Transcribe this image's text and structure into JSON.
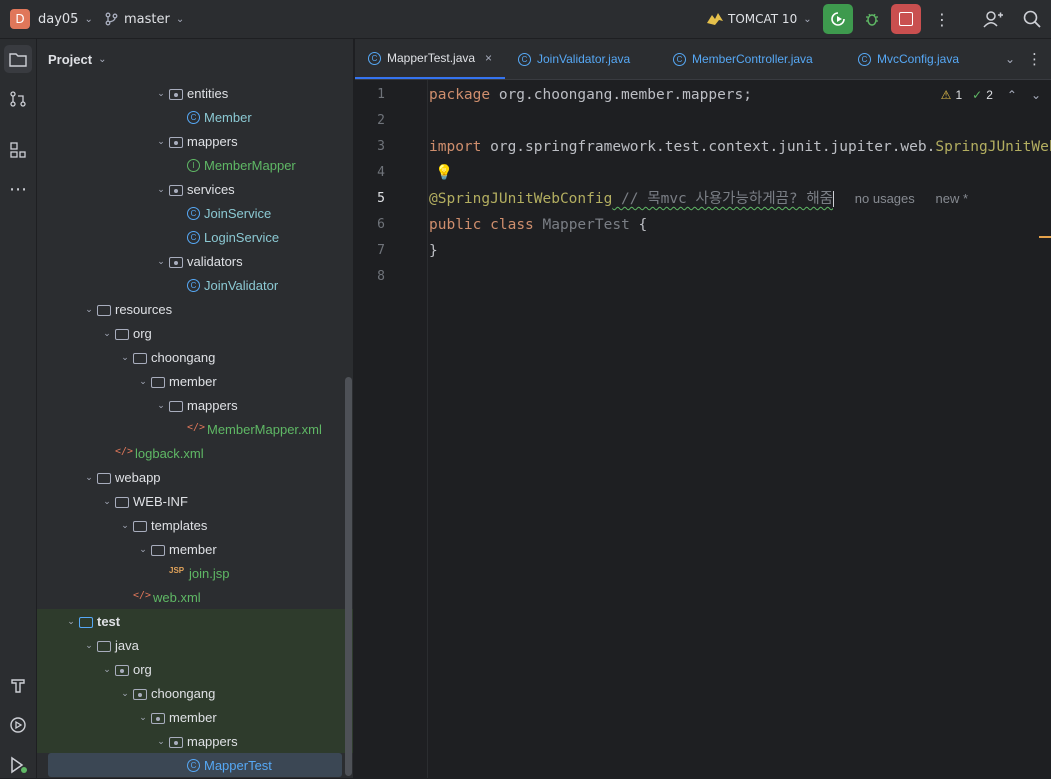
{
  "topbar": {
    "project_badge": "D",
    "project_name": "day05",
    "branch_name": "master",
    "run_config": "TOMCAT 10"
  },
  "panel": {
    "title": "Project"
  },
  "tree": [
    {
      "label": "entities",
      "type": "package",
      "indent": 6,
      "expanded": true
    },
    {
      "label": "Member",
      "type": "class",
      "indent": 7
    },
    {
      "label": "mappers",
      "type": "package",
      "indent": 6,
      "expanded": true
    },
    {
      "label": "MemberMapper",
      "type": "interface",
      "indent": 7
    },
    {
      "label": "services",
      "type": "package",
      "indent": 6,
      "expanded": true
    },
    {
      "label": "JoinService",
      "type": "class",
      "indent": 7
    },
    {
      "label": "LoginService",
      "type": "class",
      "indent": 7
    },
    {
      "label": "validators",
      "type": "package",
      "indent": 6,
      "expanded": true
    },
    {
      "label": "JoinValidator",
      "type": "class",
      "indent": 7
    },
    {
      "label": "resources",
      "type": "resfolder",
      "indent": 2,
      "expanded": true
    },
    {
      "label": "org",
      "type": "folder",
      "indent": 3,
      "expanded": true
    },
    {
      "label": "choongang",
      "type": "folder",
      "indent": 4,
      "expanded": true
    },
    {
      "label": "member",
      "type": "folder",
      "indent": 5,
      "expanded": true
    },
    {
      "label": "mappers",
      "type": "folder",
      "indent": 6,
      "expanded": true
    },
    {
      "label": "MemberMapper.xml",
      "type": "xml",
      "indent": 7
    },
    {
      "label": "logback.xml",
      "type": "xml",
      "indent": 3
    },
    {
      "label": "webapp",
      "type": "folder",
      "indent": 2,
      "expanded": true
    },
    {
      "label": "WEB-INF",
      "type": "folder",
      "indent": 3,
      "expanded": true
    },
    {
      "label": "templates",
      "type": "folder",
      "indent": 4,
      "expanded": true
    },
    {
      "label": "member",
      "type": "folder",
      "indent": 5,
      "expanded": true
    },
    {
      "label": "join.jsp",
      "type": "jsp",
      "indent": 6
    },
    {
      "label": "web.xml",
      "type": "webxml",
      "indent": 4
    },
    {
      "label": "test",
      "type": "testfolder",
      "indent": 1,
      "expanded": true,
      "test": true
    },
    {
      "label": "java",
      "type": "folder",
      "indent": 2,
      "expanded": true,
      "test": true
    },
    {
      "label": "org",
      "type": "package",
      "indent": 3,
      "expanded": true,
      "test": true
    },
    {
      "label": "choongang",
      "type": "package",
      "indent": 4,
      "expanded": true,
      "test": true
    },
    {
      "label": "member",
      "type": "package",
      "indent": 5,
      "expanded": true,
      "test": true
    },
    {
      "label": "mappers",
      "type": "package",
      "indent": 6,
      "expanded": true,
      "test": true
    },
    {
      "label": "MapperTest",
      "type": "class",
      "indent": 7,
      "test": true,
      "selected": true
    }
  ],
  "tabs": [
    {
      "label": "MapperTest.java",
      "active": true,
      "close": "×"
    },
    {
      "label": "JoinValidator.java"
    },
    {
      "label": "MemberController.java"
    },
    {
      "label": "MvcConfig.java"
    }
  ],
  "inspections": {
    "warnings": "1",
    "checks": "2"
  },
  "line_numbers": [
    "1",
    "2",
    "3",
    "4",
    "5",
    "6",
    "7",
    "8"
  ],
  "code": {
    "l1_kw": "package",
    "l1_rest": " org.choongang.member.mappers;",
    "l3_kw": "import",
    "l3_rest": " org.springframework.test.context.junit.jupiter.web.",
    "l3_tail": "SpringJUnitWebConfig;",
    "l5_ann": "@SpringJUnitWebConfig",
    "l5_comment": " // 목mvc 사용가능하게끔? 해줌",
    "l5_hint1": "no usages",
    "l5_hint2": "new *",
    "l6_kw1": "public",
    "l6_kw2": "class",
    "l6_name": "MapperTest",
    "l6_brace": " {",
    "l7": "}"
  },
  "colors": {
    "accent": "#3574f0",
    "run_green": "#3e9a4e",
    "stop_red": "#c94f4f"
  }
}
